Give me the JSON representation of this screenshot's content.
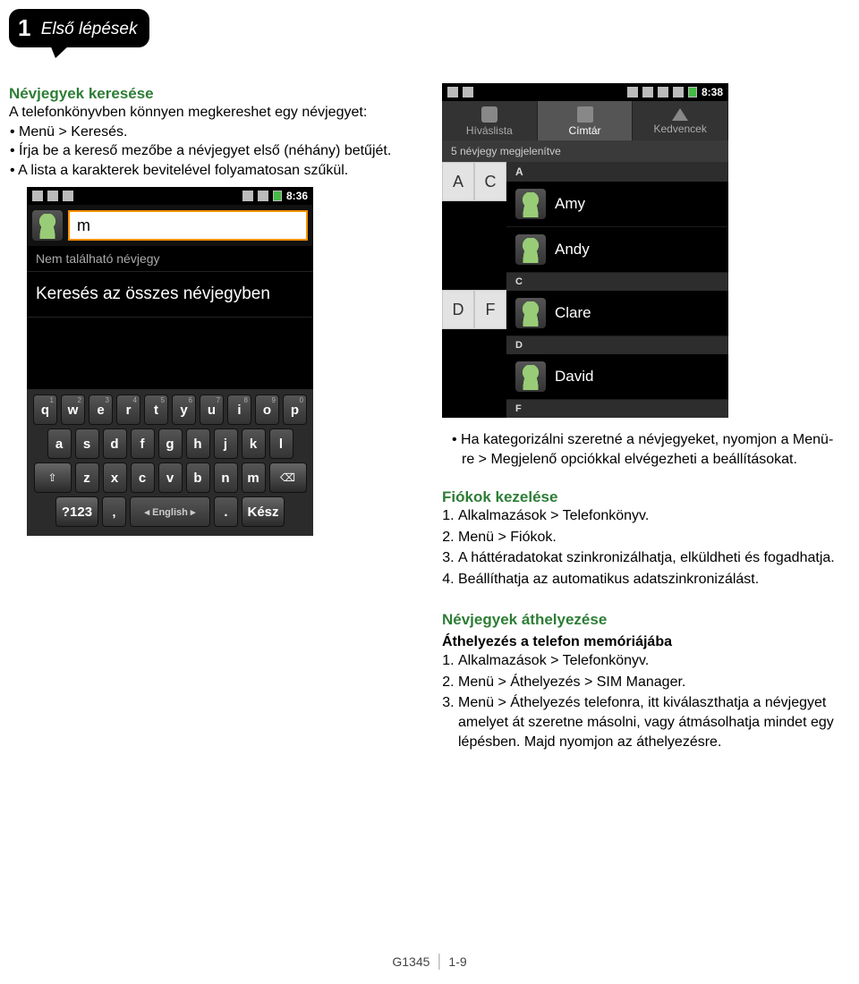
{
  "chapter": {
    "number": "1",
    "title": "Első lépések"
  },
  "left": {
    "title": "Névjegyek keresése",
    "intro": "A telefonkönyvben könnyen megkereshet egy névjegyet:",
    "b1": "• Menü > Keresés.",
    "b2": "• Írja be a kereső mezőbe a névjegyet első (néhány) betűjét.",
    "b3": "• A lista a karakterek bevitelével folyamatosan szűkül."
  },
  "phoneA": {
    "time": "8:36",
    "search_value": "m",
    "no_result": "Nem található névjegy",
    "search_all": "Keresés az összes névjegyben",
    "keyboard": {
      "row1": [
        "q",
        "w",
        "e",
        "r",
        "t",
        "y",
        "u",
        "i",
        "o",
        "p"
      ],
      "sup1": [
        "1",
        "2",
        "3",
        "4",
        "5",
        "6",
        "7",
        "8",
        "9",
        "0"
      ],
      "row2": [
        "a",
        "s",
        "d",
        "f",
        "g",
        "h",
        "j",
        "k",
        "l"
      ],
      "row3_shift": "⇧",
      "row3": [
        "z",
        "x",
        "c",
        "v",
        "b",
        "n",
        "m"
      ],
      "row3_del": "⌫",
      "row4_sym": "?123",
      "row4_lang": "English",
      "row4_done": "Kész"
    }
  },
  "phoneB": {
    "time": "8:38",
    "tabs": {
      "call": "Híváslista",
      "contacts": "Címtár",
      "fav": "Kedvencek"
    },
    "count": "5 névjegy megjelenítve",
    "index": [
      "A",
      "C",
      "D",
      "F"
    ],
    "sections": [
      {
        "hdr": "A",
        "rows": [
          "Amy",
          "Andy"
        ]
      },
      {
        "hdr": "C",
        "rows": [
          "Clare"
        ]
      },
      {
        "hdr": "D",
        "rows": [
          "David"
        ]
      },
      {
        "hdr": "F",
        "rows": []
      }
    ]
  },
  "right": {
    "catline": "• Ha kategorizálni szeretné a névjegyeket, nyomjon a Menü-re > Megjelenő opciókkal elvégezheti a beállításokat.",
    "accounts_title": "Fiókok kezelése",
    "accounts": [
      "Alkalmazások > Telefonkönyv.",
      "Menü > Fiókok.",
      "A háttéradatokat szinkronizálhatja, elküldheti és fogadhatja.",
      "Beállíthatja az automatikus adatszinkronizálást."
    ],
    "move_title": "Névjegyek áthelyezése",
    "move_sub": "Áthelyezés a telefon memóriájába",
    "move": [
      "Alkalmazások > Telefonkönyv.",
      "Menü > Áthelyezés > SIM Manager.",
      "Menü > Áthelyezés telefonra, itt kiválaszthatja a névjegyet amelyet át szeretne másolni, vagy átmásolhatja mindet egy lépésben. Majd nyomjon az áthelyezésre."
    ]
  },
  "footer": {
    "model": "G1345",
    "page": "1-9"
  }
}
